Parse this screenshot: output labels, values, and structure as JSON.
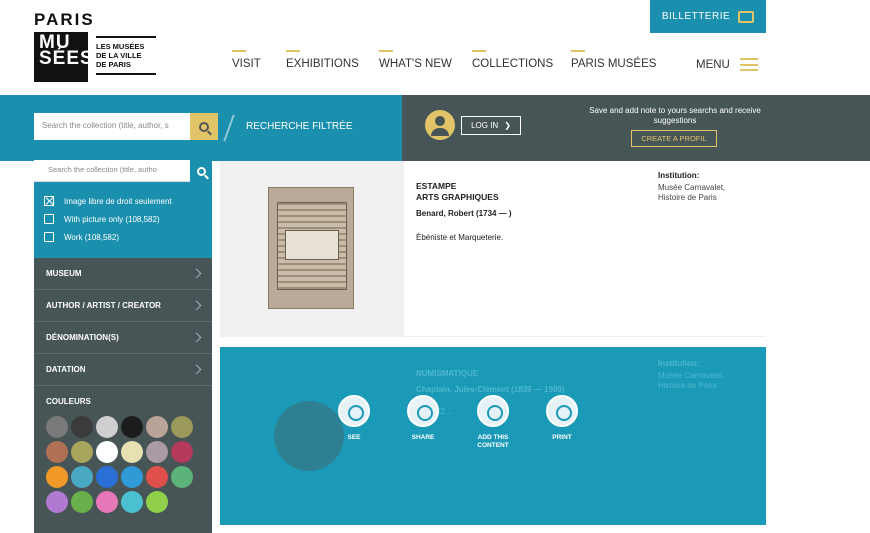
{
  "header": {
    "logo_paris": "PARIS",
    "logo_mu": "MU",
    "logo_sees": "SÉES",
    "logo_sub": [
      "LES MUSÉES",
      "DE LA VILLE",
      "DE PARIS"
    ],
    "billetterie": "BILLETTERIE",
    "nav": [
      "VISIT",
      "EXHIBITIONS",
      "WHAT'S NEW",
      "COLLECTIONS",
      "PARIS MUSÉES"
    ],
    "menu": "MENU"
  },
  "search": {
    "placeholder": "Search the collection (title, author, s",
    "filtered": "RECHERCHE FILTRÉE"
  },
  "account": {
    "login": "LOG IN",
    "save_note": "Save and add note to yours searchs and receive suggestions",
    "create": "CREATE A PROFIL"
  },
  "sidebar": {
    "search_placeholder": "Search the collection (title, autho",
    "checks": [
      {
        "label": "Image libre de droit seulement",
        "checked": true
      },
      {
        "label": "With picture only (108,582)",
        "checked": false
      },
      {
        "label": "Work (108,582)",
        "checked": false
      }
    ],
    "facets": [
      "MUSEUM",
      "AUTHOR / ARTIST / CREATOR",
      "DÉNOMINATION(S)",
      "DATATION"
    ],
    "colors_title": "COULEURS",
    "colors": [
      "#7a7a7a",
      "#3b3b3b",
      "#cfcfcf",
      "#1c1c1c",
      "#b9a49a",
      "#9b9a5a",
      "#b07056",
      "#a8a65a",
      "#ffffff",
      "#e7e0b0",
      "#a99aa6",
      "#b33a5a",
      "#f19a2a",
      "#4aa9c2",
      "#2a6fd6",
      "#2f9ad6",
      "#e0504a",
      "#5cb37a",
      "#b07ad0",
      "#6ab04a",
      "#e678b8",
      "#4ac0d0",
      "#8fcf4a"
    ]
  },
  "results": [
    {
      "type": "ESTAMPE",
      "subtype": "ARTS GRAPHIQUES",
      "author": "Benard, Robert (1734 — )",
      "title": "Ébéniste et Marqueterie.",
      "institution_label": "Institution:",
      "institution": "Musée Carnavalet, Histoire de Paris"
    },
    {
      "type": "NUMISMATIQUE",
      "author": "Chaplain, Jules-Clément (1839 — 1909)",
      "title": "... (1622...",
      "institution_label": "Institution:",
      "institution": "Musée Carnavalet, Histoire de Paris",
      "actions": [
        "SEE",
        "SHARE",
        "ADD THIS CONTENT",
        "PRINT"
      ]
    }
  ]
}
